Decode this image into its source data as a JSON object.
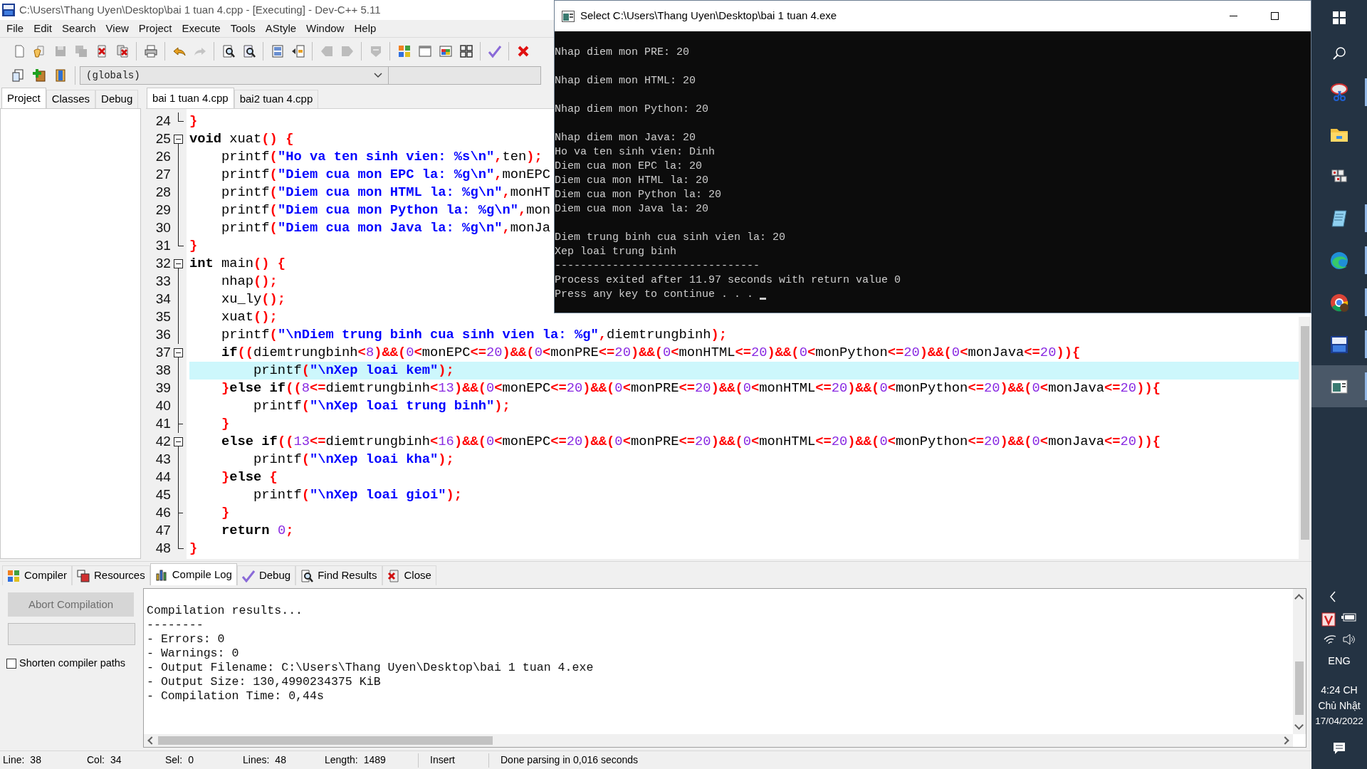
{
  "window": {
    "title": "C:\\Users\\Thang Uyen\\Desktop\\bai 1 tuan 4.cpp - [Executing] - Dev-C++ 5.11"
  },
  "menu": [
    "File",
    "Edit",
    "Search",
    "View",
    "Project",
    "Execute",
    "Tools",
    "AStyle",
    "Window",
    "Help"
  ],
  "toolbar_1": [
    {
      "disabled": false
    },
    {
      "disabled": false
    },
    {
      "disabled": true
    },
    {
      "disabled": true
    },
    {
      "disabled": false
    },
    {
      "disabled": false
    },
    {
      "disabled": false
    },
    {
      "disabled": false
    },
    {
      "disabled": true
    },
    {
      "disabled": false
    },
    {
      "disabled": false
    },
    {
      "disabled": false
    },
    {
      "disabled": false
    },
    {
      "disabled": true
    },
    {
      "disabled": true
    },
    {
      "disabled": true
    },
    {
      "disabled": false
    },
    {
      "disabled": false
    },
    {
      "disabled": false
    },
    {
      "disabled": false
    },
    {
      "disabled": false
    },
    {
      "disabled": false
    }
  ],
  "toolbar_2": {
    "scope": "(globals)"
  },
  "left_panel": {
    "tabs": [
      {
        "label": "Project",
        "selected": true
      },
      {
        "label": "Classes",
        "selected": false
      },
      {
        "label": "Debug",
        "selected": false
      }
    ]
  },
  "editor": {
    "tabs": [
      {
        "label": "bai 1 tuan 4.cpp",
        "selected": true
      },
      {
        "label": "bai2 tuan 4.cpp",
        "selected": false
      }
    ],
    "lines": [
      {
        "number": "24",
        "kind": "end",
        "current": false,
        "tokens": [
          {
            "kind": "operator",
            "text": "}"
          }
        ]
      },
      {
        "number": "25",
        "kind": "start",
        "current": false,
        "tokens": [
          {
            "kind": "keyword",
            "text": "void"
          },
          {
            "kind": "plain",
            "text": " xuat"
          },
          {
            "kind": "operator",
            "text": "() {"
          }
        ]
      },
      {
        "number": "26",
        "kind": "line",
        "current": false,
        "tokens": [
          {
            "kind": "plain",
            "text": "    printf"
          },
          {
            "kind": "operator",
            "text": "("
          },
          {
            "kind": "string",
            "text": "\"Ho va ten sinh vien: %s\\n\""
          },
          {
            "kind": "operator",
            "text": ","
          },
          {
            "kind": "plain",
            "text": "ten"
          },
          {
            "kind": "operator",
            "text": ");"
          }
        ]
      },
      {
        "number": "27",
        "kind": "line",
        "current": false,
        "tokens": [
          {
            "kind": "plain",
            "text": "    printf"
          },
          {
            "kind": "operator",
            "text": "("
          },
          {
            "kind": "string",
            "text": "\"Diem cua mon EPC la: %g\\n\""
          },
          {
            "kind": "operator",
            "text": ","
          },
          {
            "kind": "plain",
            "text": "monEPC"
          }
        ]
      },
      {
        "number": "28",
        "kind": "line",
        "current": false,
        "tokens": [
          {
            "kind": "plain",
            "text": "    printf"
          },
          {
            "kind": "operator",
            "text": "("
          },
          {
            "kind": "string",
            "text": "\"Diem cua mon HTML la: %g\\n\""
          },
          {
            "kind": "operator",
            "text": ","
          },
          {
            "kind": "plain",
            "text": "monHT"
          }
        ]
      },
      {
        "number": "29",
        "kind": "line",
        "current": false,
        "tokens": [
          {
            "kind": "plain",
            "text": "    printf"
          },
          {
            "kind": "operator",
            "text": "("
          },
          {
            "kind": "string",
            "text": "\"Diem cua mon Python la: %g\\n\""
          },
          {
            "kind": "operator",
            "text": ","
          },
          {
            "kind": "plain",
            "text": "mon"
          }
        ]
      },
      {
        "number": "30",
        "kind": "line",
        "current": false,
        "tokens": [
          {
            "kind": "plain",
            "text": "    printf"
          },
          {
            "kind": "operator",
            "text": "("
          },
          {
            "kind": "string",
            "text": "\"Diem cua mon Java la: %g\\n\""
          },
          {
            "kind": "operator",
            "text": ","
          },
          {
            "kind": "plain",
            "text": "monJa"
          }
        ]
      },
      {
        "number": "31",
        "kind": "end",
        "current": false,
        "tokens": [
          {
            "kind": "operator",
            "text": "}"
          }
        ]
      },
      {
        "number": "32",
        "kind": "start",
        "current": false,
        "tokens": [
          {
            "kind": "keyword",
            "text": "int"
          },
          {
            "kind": "plain",
            "text": " main"
          },
          {
            "kind": "operator",
            "text": "() {"
          }
        ]
      },
      {
        "number": "33",
        "kind": "line",
        "current": false,
        "tokens": [
          {
            "kind": "plain",
            "text": "    nhap"
          },
          {
            "kind": "operator",
            "text": "();"
          }
        ]
      },
      {
        "number": "34",
        "kind": "line",
        "current": false,
        "tokens": [
          {
            "kind": "plain",
            "text": "    xu_ly"
          },
          {
            "kind": "operator",
            "text": "();"
          }
        ]
      },
      {
        "number": "35",
        "kind": "line",
        "current": false,
        "tokens": [
          {
            "kind": "plain",
            "text": "    xuat"
          },
          {
            "kind": "operator",
            "text": "();"
          }
        ]
      },
      {
        "number": "36",
        "kind": "line",
        "current": false,
        "tokens": [
          {
            "kind": "plain",
            "text": "    printf"
          },
          {
            "kind": "operator",
            "text": "("
          },
          {
            "kind": "string",
            "text": "\"\\nDiem trung binh cua sinh vien la: %g\""
          },
          {
            "kind": "operator",
            "text": ","
          },
          {
            "kind": "plain",
            "text": "diemtrungbinh"
          },
          {
            "kind": "operator",
            "text": ");"
          }
        ]
      },
      {
        "number": "37",
        "kind": "start",
        "current": false,
        "tokens": [
          {
            "kind": "keyword",
            "text": "    if"
          },
          {
            "kind": "operator",
            "text": "(("
          },
          {
            "kind": "plain",
            "text": "diemtrungbinh"
          },
          {
            "kind": "operator",
            "text": "<"
          },
          {
            "kind": "number",
            "text": "8"
          },
          {
            "kind": "operator",
            "text": ")&&("
          },
          {
            "kind": "number",
            "text": "0"
          },
          {
            "kind": "operator",
            "text": "<"
          },
          {
            "kind": "plain",
            "text": "monEPC"
          },
          {
            "kind": "operator",
            "text": "<="
          },
          {
            "kind": "number",
            "text": "20"
          },
          {
            "kind": "operator",
            "text": ")&&("
          },
          {
            "kind": "number",
            "text": "0"
          },
          {
            "kind": "operator",
            "text": "<"
          },
          {
            "kind": "plain",
            "text": "monPRE"
          },
          {
            "kind": "operator",
            "text": "<="
          },
          {
            "kind": "number",
            "text": "20"
          },
          {
            "kind": "operator",
            "text": ")&&("
          },
          {
            "kind": "number",
            "text": "0"
          },
          {
            "kind": "operator",
            "text": "<"
          },
          {
            "kind": "plain",
            "text": "monHTML"
          },
          {
            "kind": "operator",
            "text": "<="
          },
          {
            "kind": "number",
            "text": "20"
          },
          {
            "kind": "operator",
            "text": ")&&("
          },
          {
            "kind": "number",
            "text": "0"
          },
          {
            "kind": "operator",
            "text": "<"
          },
          {
            "kind": "plain",
            "text": "monPython"
          },
          {
            "kind": "operator",
            "text": "<="
          },
          {
            "kind": "number",
            "text": "20"
          },
          {
            "kind": "operator",
            "text": ")&&("
          },
          {
            "kind": "number",
            "text": "0"
          },
          {
            "kind": "operator",
            "text": "<"
          },
          {
            "kind": "plain",
            "text": "monJava"
          },
          {
            "kind": "operator",
            "text": "<="
          },
          {
            "kind": "number",
            "text": "20"
          },
          {
            "kind": "operator",
            "text": ")){"
          }
        ]
      },
      {
        "number": "38",
        "kind": "line",
        "current": true,
        "tokens": [
          {
            "kind": "plain",
            "text": "        printf"
          },
          {
            "kind": "operator",
            "text": "("
          },
          {
            "kind": "string",
            "text": "\"\\nXep loai kem\""
          },
          {
            "kind": "operator",
            "text": ");"
          }
        ]
      },
      {
        "number": "39",
        "kind": "line",
        "current": false,
        "tokens": [
          {
            "kind": "operator",
            "text": "    }"
          },
          {
            "kind": "keyword",
            "text": "else if"
          },
          {
            "kind": "operator",
            "text": "(("
          },
          {
            "kind": "number",
            "text": "8"
          },
          {
            "kind": "operator",
            "text": "<="
          },
          {
            "kind": "plain",
            "text": "diemtrungbinh"
          },
          {
            "kind": "operator",
            "text": "<"
          },
          {
            "kind": "number",
            "text": "13"
          },
          {
            "kind": "operator",
            "text": ")&&("
          },
          {
            "kind": "number",
            "text": "0"
          },
          {
            "kind": "operator",
            "text": "<"
          },
          {
            "kind": "plain",
            "text": "monEPC"
          },
          {
            "kind": "operator",
            "text": "<="
          },
          {
            "kind": "number",
            "text": "20"
          },
          {
            "kind": "operator",
            "text": ")&&("
          },
          {
            "kind": "number",
            "text": "0"
          },
          {
            "kind": "operator",
            "text": "<"
          },
          {
            "kind": "plain",
            "text": "monPRE"
          },
          {
            "kind": "operator",
            "text": "<="
          },
          {
            "kind": "number",
            "text": "20"
          },
          {
            "kind": "operator",
            "text": ")&&("
          },
          {
            "kind": "number",
            "text": "0"
          },
          {
            "kind": "operator",
            "text": "<"
          },
          {
            "kind": "plain",
            "text": "monHTML"
          },
          {
            "kind": "operator",
            "text": "<="
          },
          {
            "kind": "number",
            "text": "20"
          },
          {
            "kind": "operator",
            "text": ")&&("
          },
          {
            "kind": "number",
            "text": "0"
          },
          {
            "kind": "operator",
            "text": "<"
          },
          {
            "kind": "plain",
            "text": "monPython"
          },
          {
            "kind": "operator",
            "text": "<="
          },
          {
            "kind": "number",
            "text": "20"
          },
          {
            "kind": "operator",
            "text": ")&&("
          },
          {
            "kind": "number",
            "text": "0"
          },
          {
            "kind": "operator",
            "text": "<"
          },
          {
            "kind": "plain",
            "text": "monJava"
          },
          {
            "kind": "operator",
            "text": "<="
          },
          {
            "kind": "number",
            "text": "20"
          },
          {
            "kind": "operator",
            "text": ")){"
          }
        ]
      },
      {
        "number": "40",
        "kind": "line",
        "current": false,
        "tokens": [
          {
            "kind": "plain",
            "text": "        printf"
          },
          {
            "kind": "operator",
            "text": "("
          },
          {
            "kind": "string",
            "text": "\"\\nXep loai trung binh\""
          },
          {
            "kind": "operator",
            "text": ");"
          }
        ]
      },
      {
        "number": "41",
        "kind": "branch",
        "current": false,
        "tokens": [
          {
            "kind": "operator",
            "text": "    }"
          }
        ]
      },
      {
        "number": "42",
        "kind": "start",
        "current": false,
        "tokens": [
          {
            "kind": "keyword",
            "text": "    else if"
          },
          {
            "kind": "operator",
            "text": "(("
          },
          {
            "kind": "number",
            "text": "13"
          },
          {
            "kind": "operator",
            "text": "<="
          },
          {
            "kind": "plain",
            "text": "diemtrungbinh"
          },
          {
            "kind": "operator",
            "text": "<"
          },
          {
            "kind": "number",
            "text": "16"
          },
          {
            "kind": "operator",
            "text": ")&&("
          },
          {
            "kind": "number",
            "text": "0"
          },
          {
            "kind": "operator",
            "text": "<"
          },
          {
            "kind": "plain",
            "text": "monEPC"
          },
          {
            "kind": "operator",
            "text": "<="
          },
          {
            "kind": "number",
            "text": "20"
          },
          {
            "kind": "operator",
            "text": ")&&("
          },
          {
            "kind": "number",
            "text": "0"
          },
          {
            "kind": "operator",
            "text": "<"
          },
          {
            "kind": "plain",
            "text": "monPRE"
          },
          {
            "kind": "operator",
            "text": "<="
          },
          {
            "kind": "number",
            "text": "20"
          },
          {
            "kind": "operator",
            "text": ")&&("
          },
          {
            "kind": "number",
            "text": "0"
          },
          {
            "kind": "operator",
            "text": "<"
          },
          {
            "kind": "plain",
            "text": "monHTML"
          },
          {
            "kind": "operator",
            "text": "<="
          },
          {
            "kind": "number",
            "text": "20"
          },
          {
            "kind": "operator",
            "text": ")&&("
          },
          {
            "kind": "number",
            "text": "0"
          },
          {
            "kind": "operator",
            "text": "<"
          },
          {
            "kind": "plain",
            "text": "monPython"
          },
          {
            "kind": "operator",
            "text": "<="
          },
          {
            "kind": "number",
            "text": "20"
          },
          {
            "kind": "operator",
            "text": ")&&("
          },
          {
            "kind": "number",
            "text": "0"
          },
          {
            "kind": "operator",
            "text": "<"
          },
          {
            "kind": "plain",
            "text": "monJava"
          },
          {
            "kind": "operator",
            "text": "<="
          },
          {
            "kind": "number",
            "text": "20"
          },
          {
            "kind": "operator",
            "text": ")){"
          }
        ]
      },
      {
        "number": "43",
        "kind": "line",
        "current": false,
        "tokens": [
          {
            "kind": "plain",
            "text": "        printf"
          },
          {
            "kind": "operator",
            "text": "("
          },
          {
            "kind": "string",
            "text": "\"\\nXep loai kha\""
          },
          {
            "kind": "operator",
            "text": ");"
          }
        ]
      },
      {
        "number": "44",
        "kind": "line",
        "current": false,
        "tokens": [
          {
            "kind": "operator",
            "text": "    }"
          },
          {
            "kind": "keyword",
            "text": "else"
          },
          {
            "kind": "operator",
            "text": " {"
          }
        ]
      },
      {
        "number": "45",
        "kind": "line",
        "current": false,
        "tokens": [
          {
            "kind": "plain",
            "text": "        printf"
          },
          {
            "kind": "operator",
            "text": "("
          },
          {
            "kind": "string",
            "text": "\"\\nXep loai gioi\""
          },
          {
            "kind": "operator",
            "text": ");"
          }
        ]
      },
      {
        "number": "46",
        "kind": "branch",
        "current": false,
        "tokens": [
          {
            "kind": "operator",
            "text": "    }"
          }
        ]
      },
      {
        "number": "47",
        "kind": "line",
        "current": false,
        "tokens": [
          {
            "kind": "keyword",
            "text": "    return"
          },
          {
            "kind": "number",
            "text": " 0"
          },
          {
            "kind": "operator",
            "text": ";"
          }
        ]
      },
      {
        "number": "48",
        "kind": "end",
        "current": false,
        "tokens": [
          {
            "kind": "operator",
            "text": "}"
          }
        ]
      }
    ]
  },
  "console": {
    "title": "Select C:\\Users\\Thang Uyen\\Desktop\\bai 1 tuan 4.exe",
    "blocks": [
      [
        "Nhap diem mon PRE: 20"
      ],
      [
        "Nhap diem mon HTML: 20"
      ],
      [
        "Nhap diem mon Python: 20"
      ],
      [
        "Nhap diem mon Java: 20",
        "Ho va ten sinh vien: Dinh",
        "Diem cua mon EPC la: 20",
        "Diem cua mon HTML la: 20",
        "Diem cua mon Python la: 20",
        "Diem cua mon Java la: 20"
      ],
      [
        "Diem trung binh cua sinh vien la: 20",
        "Xep loai trung binh",
        "--------------------------------",
        "Process exited after 11.97 seconds with return value 0",
        "Press any key to continue . . ."
      ]
    ]
  },
  "bottom_tabs": [
    {
      "label": "Compiler",
      "selected": false
    },
    {
      "label": "Resources",
      "selected": false
    },
    {
      "label": "Compile Log",
      "selected": true
    },
    {
      "label": "Debug",
      "selected": false
    },
    {
      "label": "Find Results",
      "selected": false
    },
    {
      "label": "Close",
      "selected": false
    }
  ],
  "compile_panel": {
    "abort_button": {
      "label": "Abort Compilation",
      "disabled": true
    },
    "shorten_paths": {
      "label": "Shorten compiler paths",
      "checked": false
    },
    "log": [
      "Compilation results...",
      "--------",
      "- Errors: 0",
      "- Warnings: 0",
      "- Output Filename: C:\\Users\\Thang Uyen\\Desktop\\bai 1 tuan 4.exe",
      "- Output Size: 130,4990234375 KiB",
      "- Compilation Time: 0,44s"
    ]
  },
  "status_bar": {
    "fields": [
      {
        "label": "Line:",
        "value": "38"
      },
      {
        "label": "Col:",
        "value": "34"
      },
      {
        "label": "Sel:",
        "value": "0"
      },
      {
        "label": "Lines:",
        "value": "48"
      },
      {
        "label": "Length:",
        "value": "1489"
      }
    ],
    "mode": "Insert",
    "message": "Done parsing in 0,016 seconds"
  },
  "taskbar": {
    "apps": [
      {
        "running": true,
        "selected": false
      },
      {
        "running": false,
        "selected": false
      },
      {
        "running": false,
        "selected": false
      },
      {
        "running": true,
        "selected": false
      },
      {
        "running": true,
        "selected": false
      },
      {
        "running": true,
        "selected": false
      },
      {
        "running": true,
        "selected": false
      },
      {
        "running": true,
        "selected": true
      }
    ],
    "language": "ENG",
    "time": "4:24 CH",
    "day": "Chủ Nhật",
    "date": "17/04/2022"
  }
}
